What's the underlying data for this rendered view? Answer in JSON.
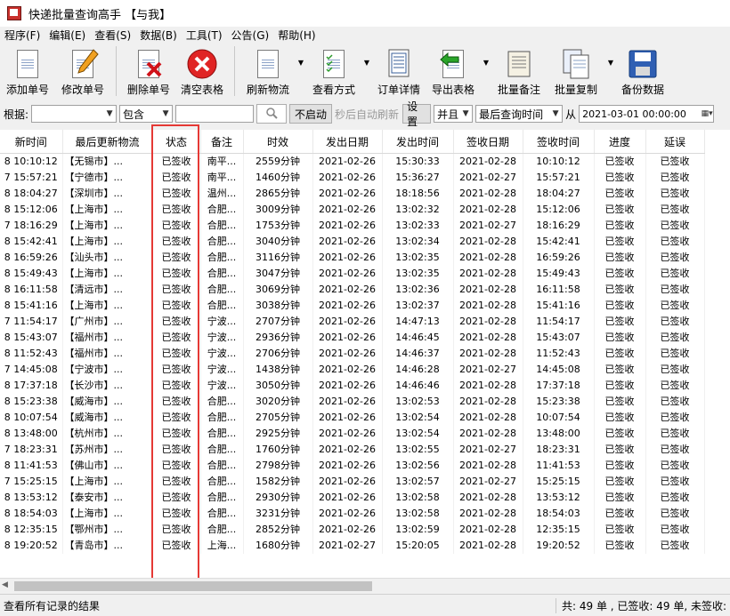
{
  "window": {
    "title": "快递批量查询高手 【与我】"
  },
  "menu": [
    {
      "label": "程序(F)"
    },
    {
      "label": "编辑(E)"
    },
    {
      "label": "查看(S)"
    },
    {
      "label": "数据(B)"
    },
    {
      "label": "工具(T)"
    },
    {
      "label": "公告(G)"
    },
    {
      "label": "帮助(H)"
    }
  ],
  "toolbar": [
    {
      "label": "添加单号",
      "icon": "add-doc-icon"
    },
    {
      "label": "修改单号",
      "icon": "edit-doc-icon"
    },
    {
      "label": "删除单号",
      "icon": "delete-doc-icon"
    },
    {
      "label": "清空表格",
      "icon": "clear-icon"
    },
    {
      "label": "刷新物流",
      "icon": "refresh-doc-icon"
    },
    {
      "label": "查看方式",
      "icon": "view-mode-icon"
    },
    {
      "label": "订单详情",
      "icon": "order-detail-icon"
    },
    {
      "label": "导出表格",
      "icon": "export-icon"
    },
    {
      "label": "批量备注",
      "icon": "scroll-icon"
    },
    {
      "label": "批量复制",
      "icon": "copy-icon"
    },
    {
      "label": "备份数据",
      "icon": "floppy-icon"
    }
  ],
  "filter": {
    "label": "根据:",
    "field_value": "",
    "match_value": "包含",
    "search_value": "",
    "auto_button": "不启动",
    "auto_text": "秒后自动刷新",
    "settings_button": "设置",
    "logic_value": "并且",
    "date_field_value": "最后查询时间",
    "from_label": "从",
    "from_value": "2021-03-01 00:00:00"
  },
  "table": {
    "columns": [
      "新时间",
      "最后更新物流",
      "状态",
      "备注",
      "时效",
      "发出日期",
      "发出时间",
      "签收日期",
      "签收时间",
      "进度",
      "延误"
    ],
    "rows": [
      [
        "8 10:10:12",
        "【无锡市】...",
        "已签收",
        "南平...",
        "2559分钟",
        "2021-02-26",
        "15:30:33",
        "2021-02-28",
        "10:10:12",
        "已签收",
        "已签收"
      ],
      [
        "7 15:57:21",
        "【宁德市】...",
        "已签收",
        "南平...",
        "1460分钟",
        "2021-02-26",
        "15:36:27",
        "2021-02-27",
        "15:57:21",
        "已签收",
        "已签收"
      ],
      [
        "8 18:04:27",
        "【深圳市】...",
        "已签收",
        "温州...",
        "2865分钟",
        "2021-02-26",
        "18:18:56",
        "2021-02-28",
        "18:04:27",
        "已签收",
        "已签收"
      ],
      [
        "8 15:12:06",
        "【上海市】...",
        "已签收",
        "合肥...",
        "3009分钟",
        "2021-02-26",
        "13:02:32",
        "2021-02-28",
        "15:12:06",
        "已签收",
        "已签收"
      ],
      [
        "7 18:16:29",
        "【上海市】...",
        "已签收",
        "合肥...",
        "1753分钟",
        "2021-02-26",
        "13:02:33",
        "2021-02-27",
        "18:16:29",
        "已签收",
        "已签收"
      ],
      [
        "8 15:42:41",
        "【上海市】...",
        "已签收",
        "合肥...",
        "3040分钟",
        "2021-02-26",
        "13:02:34",
        "2021-02-28",
        "15:42:41",
        "已签收",
        "已签收"
      ],
      [
        "8 16:59:26",
        "【汕头市】...",
        "已签收",
        "合肥...",
        "3116分钟",
        "2021-02-26",
        "13:02:35",
        "2021-02-28",
        "16:59:26",
        "已签收",
        "已签收"
      ],
      [
        "8 15:49:43",
        "【上海市】...",
        "已签收",
        "合肥...",
        "3047分钟",
        "2021-02-26",
        "13:02:35",
        "2021-02-28",
        "15:49:43",
        "已签收",
        "已签收"
      ],
      [
        "8 16:11:58",
        "【清远市】...",
        "已签收",
        "合肥...",
        "3069分钟",
        "2021-02-26",
        "13:02:36",
        "2021-02-28",
        "16:11:58",
        "已签收",
        "已签收"
      ],
      [
        "8 15:41:16",
        "【上海市】...",
        "已签收",
        "合肥...",
        "3038分钟",
        "2021-02-26",
        "13:02:37",
        "2021-02-28",
        "15:41:16",
        "已签收",
        "已签收"
      ],
      [
        "7 11:54:17",
        "【广州市】...",
        "已签收",
        "宁波...",
        "2707分钟",
        "2021-02-26",
        "14:47:13",
        "2021-02-28",
        "11:54:17",
        "已签收",
        "已签收"
      ],
      [
        "8 15:43:07",
        "【福州市】...",
        "已签收",
        "宁波...",
        "2936分钟",
        "2021-02-26",
        "14:46:45",
        "2021-02-28",
        "15:43:07",
        "已签收",
        "已签收"
      ],
      [
        "8 11:52:43",
        "【福州市】...",
        "已签收",
        "宁波...",
        "2706分钟",
        "2021-02-26",
        "14:46:37",
        "2021-02-28",
        "11:52:43",
        "已签收",
        "已签收"
      ],
      [
        "7 14:45:08",
        "【宁波市】...",
        "已签收",
        "宁波...",
        "1438分钟",
        "2021-02-26",
        "14:46:28",
        "2021-02-27",
        "14:45:08",
        "已签收",
        "已签收"
      ],
      [
        "8 17:37:18",
        "【长沙市】...",
        "已签收",
        "宁波...",
        "3050分钟",
        "2021-02-26",
        "14:46:46",
        "2021-02-28",
        "17:37:18",
        "已签收",
        "已签收"
      ],
      [
        "8 15:23:38",
        "【威海市】...",
        "已签收",
        "合肥...",
        "3020分钟",
        "2021-02-26",
        "13:02:53",
        "2021-02-28",
        "15:23:38",
        "已签收",
        "已签收"
      ],
      [
        "8 10:07:54",
        "【威海市】...",
        "已签收",
        "合肥...",
        "2705分钟",
        "2021-02-26",
        "13:02:54",
        "2021-02-28",
        "10:07:54",
        "已签收",
        "已签收"
      ],
      [
        "8 13:48:00",
        "【杭州市】...",
        "已签收",
        "合肥...",
        "2925分钟",
        "2021-02-26",
        "13:02:54",
        "2021-02-28",
        "13:48:00",
        "已签收",
        "已签收"
      ],
      [
        "7 18:23:31",
        "【苏州市】...",
        "已签收",
        "合肥...",
        "1760分钟",
        "2021-02-26",
        "13:02:55",
        "2021-02-27",
        "18:23:31",
        "已签收",
        "已签收"
      ],
      [
        "8 11:41:53",
        "【佛山市】...",
        "已签收",
        "合肥...",
        "2798分钟",
        "2021-02-26",
        "13:02:56",
        "2021-02-28",
        "11:41:53",
        "已签收",
        "已签收"
      ],
      [
        "7 15:25:15",
        "【上海市】...",
        "已签收",
        "合肥...",
        "1582分钟",
        "2021-02-26",
        "13:02:57",
        "2021-02-27",
        "15:25:15",
        "已签收",
        "已签收"
      ],
      [
        "8 13:53:12",
        "【泰安市】...",
        "已签收",
        "合肥...",
        "2930分钟",
        "2021-02-26",
        "13:02:58",
        "2021-02-28",
        "13:53:12",
        "已签收",
        "已签收"
      ],
      [
        "8 18:54:03",
        "【上海市】...",
        "已签收",
        "合肥...",
        "3231分钟",
        "2021-02-26",
        "13:02:58",
        "2021-02-28",
        "18:54:03",
        "已签收",
        "已签收"
      ],
      [
        "8 12:35:15",
        "【鄂州市】...",
        "已签收",
        "合肥...",
        "2852分钟",
        "2021-02-26",
        "13:02:59",
        "2021-02-28",
        "12:35:15",
        "已签收",
        "已签收"
      ],
      [
        "8 19:20:52",
        "【青岛市】...",
        "已签收",
        "上海...",
        "1680分钟",
        "2021-02-27",
        "15:20:05",
        "2021-02-28",
        "19:20:52",
        "已签收",
        "已签收"
      ]
    ]
  },
  "status": {
    "left": "查看所有记录的结果",
    "right": "共: 49 单 , 已签收:  49 单, 未签收:"
  },
  "colors": {
    "highlight_box": "#e53935"
  }
}
